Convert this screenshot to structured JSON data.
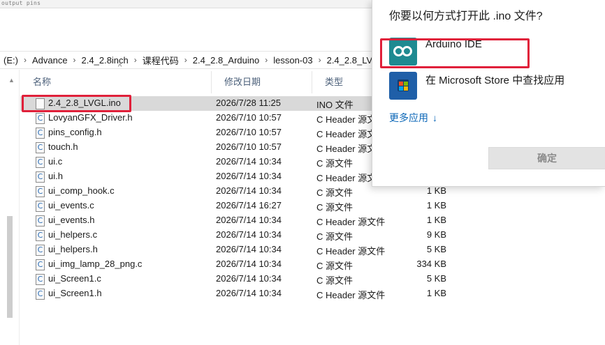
{
  "top_strip_text": "output pins",
  "address_bar": {
    "crumbs": [
      "(E:)",
      "Advance",
      "2.4_2.8inch",
      "课程代码",
      "2.4_2.8_Arduino",
      "lesson-03",
      "2.4_2.8_LV"
    ]
  },
  "columns": {
    "name": "名称",
    "date": "修改日期",
    "type": "类型"
  },
  "files": [
    {
      "name": "2.4_2.8_LVGL.ino",
      "date": "2026/7/28 11:25",
      "type": "INO 文件",
      "size": "",
      "icon": "ino-file-icon"
    },
    {
      "name": "LovyanGFX_Driver.h",
      "date": "2026/7/10 10:57",
      "type": "C Header 源文",
      "size": "",
      "icon": "c-file-icon"
    },
    {
      "name": "pins_config.h",
      "date": "2026/7/10 10:57",
      "type": "C Header 源文",
      "size": "",
      "icon": "c-file-icon"
    },
    {
      "name": "touch.h",
      "date": "2026/7/10 10:57",
      "type": "C Header 源文",
      "size": "",
      "icon": "c-file-icon"
    },
    {
      "name": "ui.c",
      "date": "2026/7/14 10:34",
      "type": "C 源文件",
      "size": "",
      "icon": "c-file-icon"
    },
    {
      "name": "ui.h",
      "date": "2026/7/14 10:34",
      "type": "C Header 源文",
      "size": "",
      "icon": "c-file-icon"
    },
    {
      "name": "ui_comp_hook.c",
      "date": "2026/7/14 10:34",
      "type": "C 源文件",
      "size": "1 KB",
      "icon": "c-file-icon"
    },
    {
      "name": "ui_events.c",
      "date": "2026/7/14 16:27",
      "type": "C 源文件",
      "size": "1 KB",
      "icon": "c-file-icon"
    },
    {
      "name": "ui_events.h",
      "date": "2026/7/14 10:34",
      "type": "C Header 源文件",
      "size": "1 KB",
      "icon": "c-file-icon"
    },
    {
      "name": "ui_helpers.c",
      "date": "2026/7/14 10:34",
      "type": "C 源文件",
      "size": "9 KB",
      "icon": "c-file-icon"
    },
    {
      "name": "ui_helpers.h",
      "date": "2026/7/14 10:34",
      "type": "C Header 源文件",
      "size": "5 KB",
      "icon": "c-file-icon"
    },
    {
      "name": "ui_img_lamp_28_png.c",
      "date": "2026/7/14 10:34",
      "type": "C 源文件",
      "size": "334 KB",
      "icon": "c-file-icon"
    },
    {
      "name": "ui_Screen1.c",
      "date": "2026/7/14 10:34",
      "type": "C 源文件",
      "size": "5 KB",
      "icon": "c-file-icon"
    },
    {
      "name": "ui_Screen1.h",
      "date": "2026/7/14 10:34",
      "type": "C Header 源文件",
      "size": "1 KB",
      "icon": "c-file-icon"
    }
  ],
  "file_icon_glyph": "C",
  "open_with": {
    "title": "你要以何方式打开此 .ino 文件?",
    "apps": [
      {
        "label": "Arduino IDE",
        "icon": "arduino-icon"
      },
      {
        "label": "在 Microsoft Store 中查找应用",
        "icon": "microsoft-store-icon"
      }
    ],
    "more_apps": "更多应用",
    "more_arrow": "↓",
    "ok_button": "确定"
  },
  "colors": {
    "highlight": "#e0203a",
    "link": "#0a66b7",
    "selection": "#d9d9d9",
    "arduino_teal": "#1e8a91"
  }
}
